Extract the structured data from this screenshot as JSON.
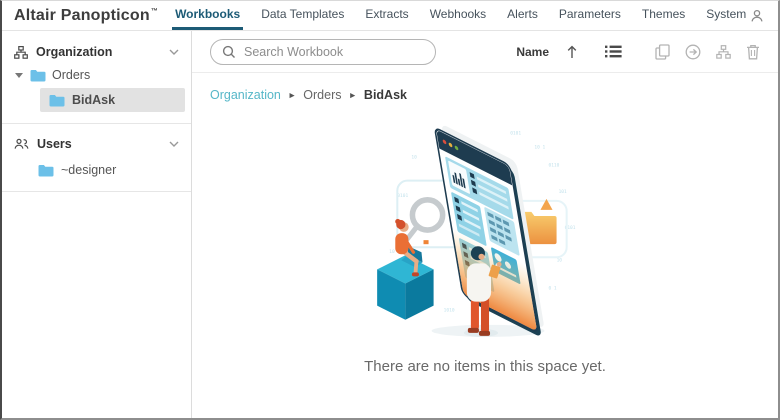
{
  "brand": {
    "name": "Altair Panopticon",
    "trademark": "™"
  },
  "nav": {
    "tabs": [
      {
        "label": "Workbooks",
        "active": true
      },
      {
        "label": "Data Templates",
        "active": false
      },
      {
        "label": "Extracts",
        "active": false
      },
      {
        "label": "Webhooks",
        "active": false
      },
      {
        "label": "Alerts",
        "active": false
      },
      {
        "label": "Parameters",
        "active": false
      },
      {
        "label": "Themes",
        "active": false
      },
      {
        "label": "System",
        "active": false
      }
    ]
  },
  "sidebar": {
    "organization": {
      "label": "Organization",
      "icon": "org-chart-icon",
      "expanded": true
    },
    "orders": {
      "label": "Orders",
      "icon": "folder-icon",
      "expanded": true
    },
    "bidask": {
      "label": "BidAsk",
      "icon": "folder-icon",
      "selected": true
    },
    "users": {
      "label": "Users",
      "icon": "users-icon",
      "expanded": true
    },
    "designer": {
      "label": "~designer",
      "icon": "folder-icon"
    }
  },
  "toolbar": {
    "search_placeholder": "Search Workbook",
    "search_value": "",
    "sort_label": "Name",
    "sort_direction": "ascending",
    "icons": [
      "list-view-icon",
      "copy-icon",
      "move-icon",
      "subfolder-icon",
      "delete-icon"
    ]
  },
  "breadcrumb": {
    "separator": "►",
    "items": [
      "Organization",
      "Orders",
      "BidAsk"
    ]
  },
  "main": {
    "empty_message": "There are no items in this space yet."
  },
  "colors": {
    "accent_teal": "#1d5b76",
    "breadcrumb_link": "#56b7c8",
    "folder_blue": "#6cc0e8",
    "selected_row_bg": "#e2e2e2",
    "illustration_teal": "#8fd2e6",
    "illustration_navy": "#1e3c50",
    "illustration_orange": "#ed8136"
  }
}
